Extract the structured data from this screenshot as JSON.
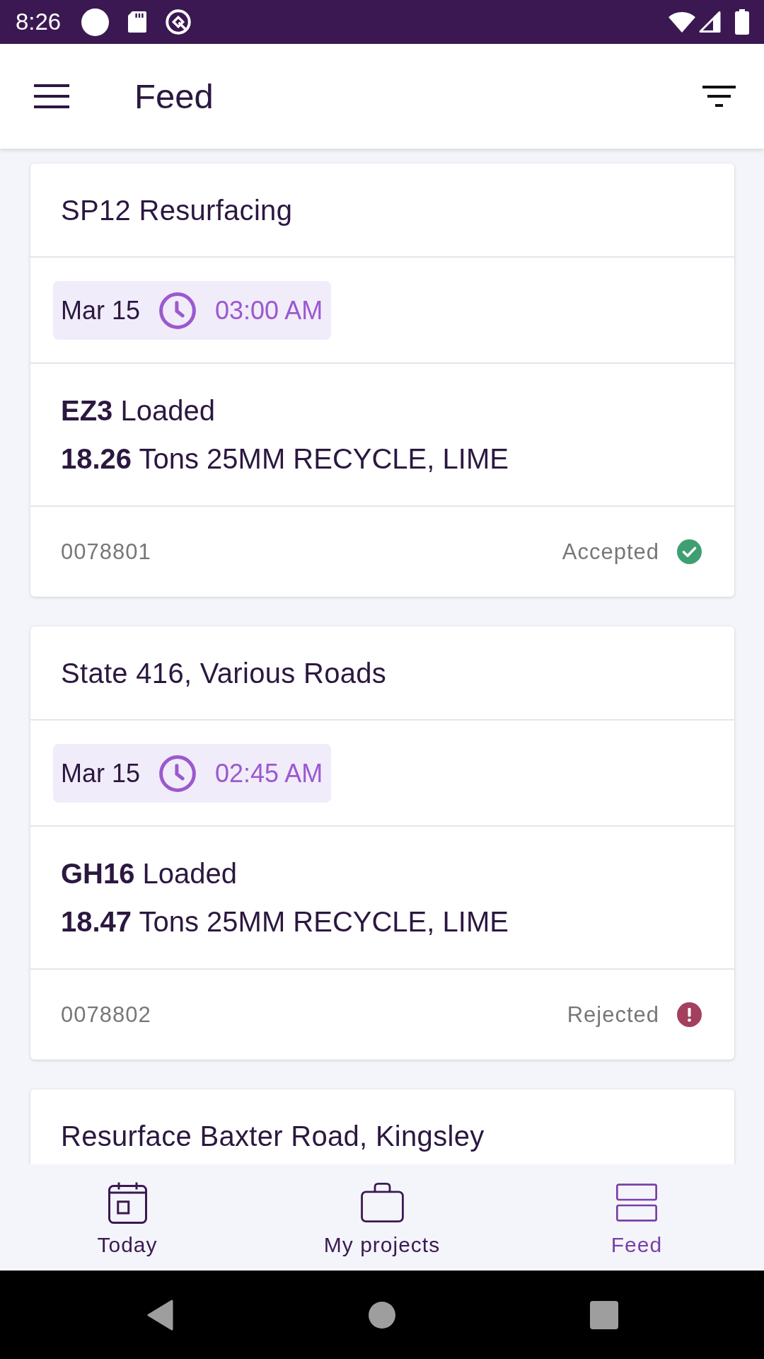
{
  "status_bar": {
    "time": "8:26"
  },
  "app_bar": {
    "title": "Feed"
  },
  "feed": [
    {
      "project": "SP12 Resurfacing",
      "date": "Mar 15",
      "time": "03:00 AM",
      "load_line": "**EZ3** Loaded",
      "quantity_line": "**18.26** Tons 25MM RECYCLE, LIME",
      "ticket": "0078801",
      "status": {
        "label": "Accepted",
        "kind": "accepted"
      }
    },
    {
      "project": "State 416, Various Roads",
      "date": "Mar 15",
      "time": "02:45 AM",
      "load_line": "**GH16** Loaded",
      "quantity_line": "**18.47** Tons 25MM RECYCLE, LIME",
      "ticket": "0078802",
      "status": {
        "label": "Rejected",
        "kind": "rejected"
      }
    },
    {
      "project": "Resurface Baxter Road, Kingsley"
    }
  ],
  "bottom_nav": [
    {
      "label": "Today",
      "selected": false
    },
    {
      "label": "My projects",
      "selected": false
    },
    {
      "label": "Feed",
      "selected": true
    }
  ]
}
